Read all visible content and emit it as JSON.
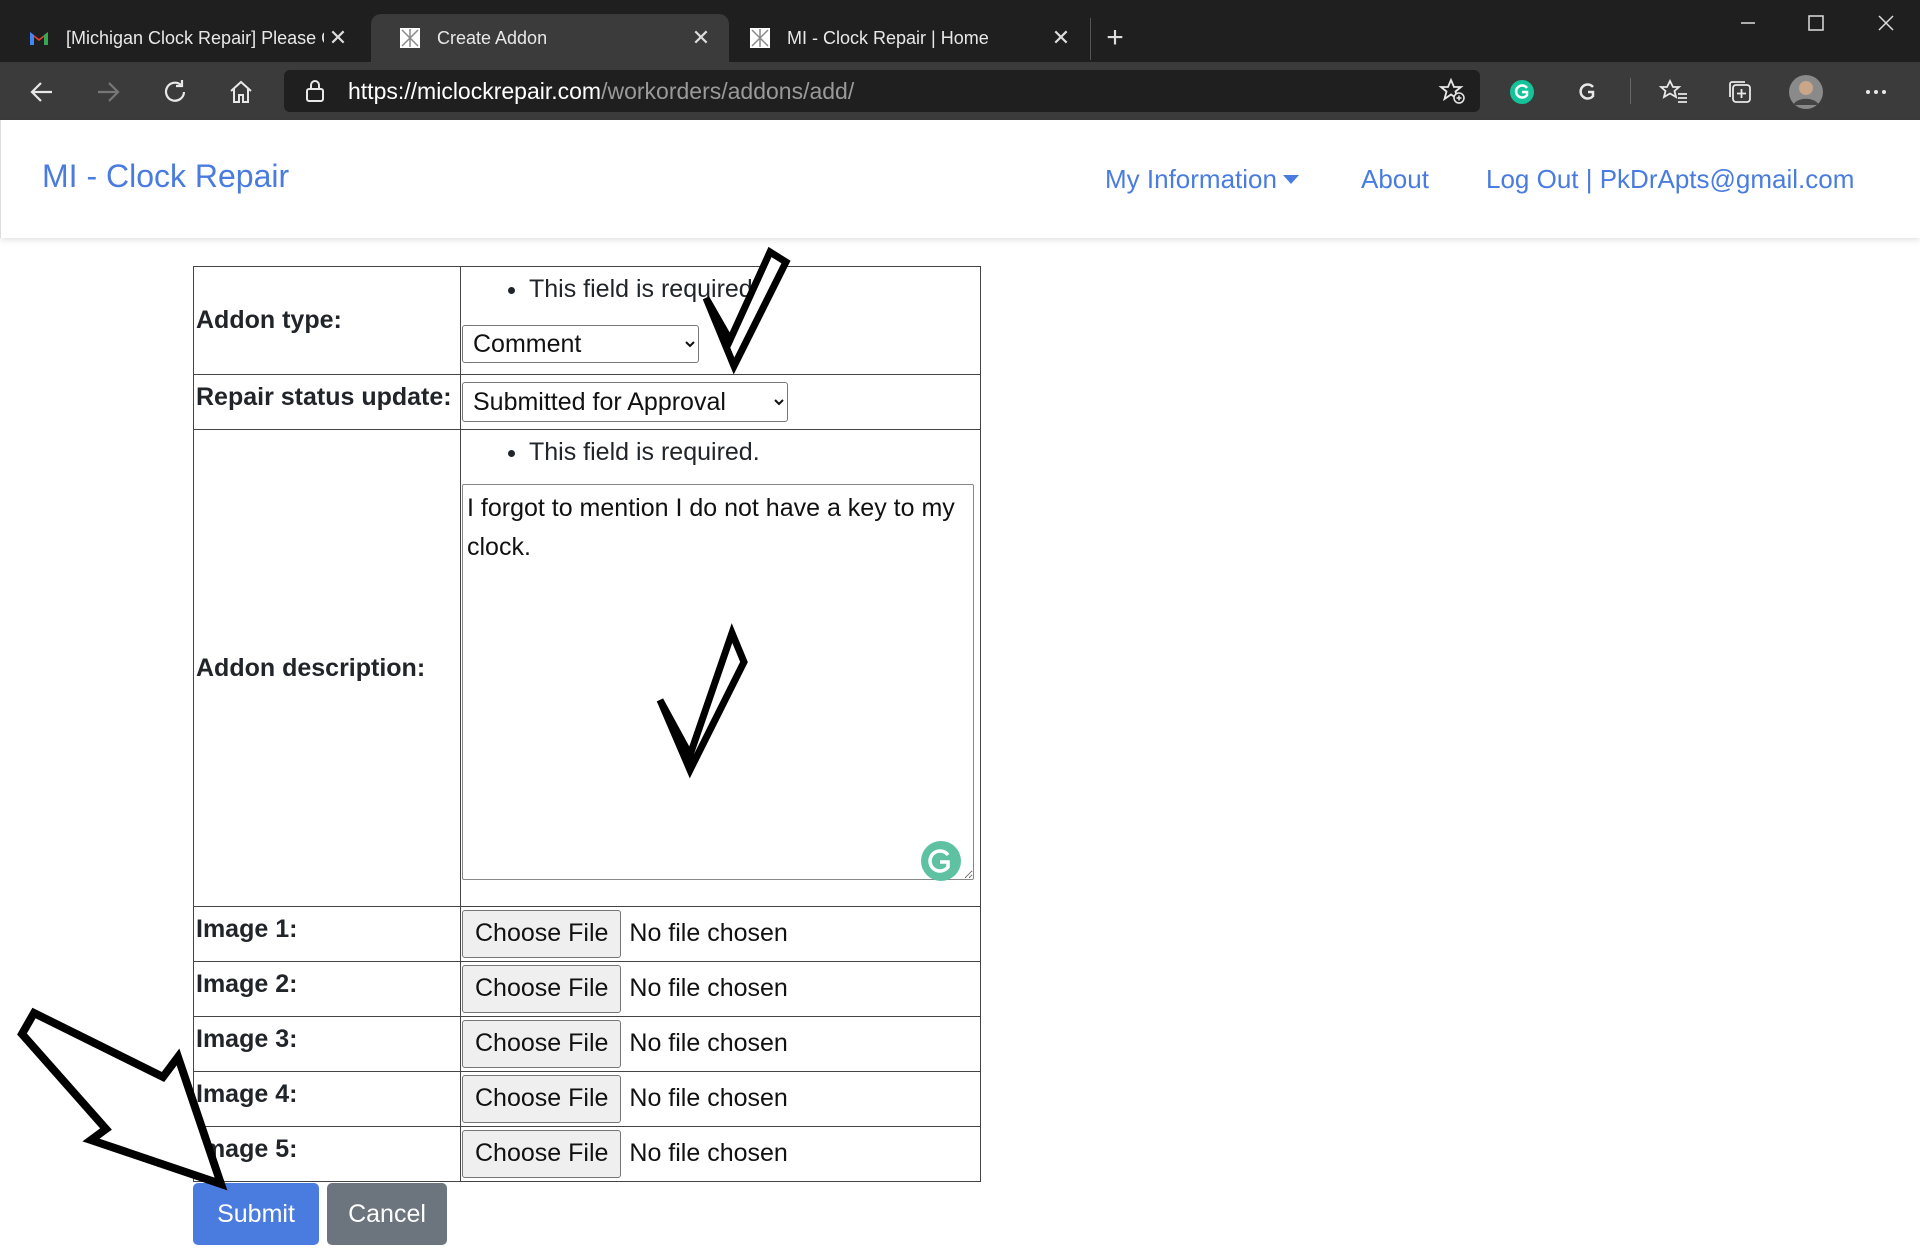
{
  "browser": {
    "tabs": [
      {
        "title": "[Michigan Clock Repair] Please C",
        "active": false,
        "icon": "gmail-icon"
      },
      {
        "title": "Create Addon",
        "active": true,
        "icon": "site-favicon"
      },
      {
        "title": "MI - Clock Repair | Home",
        "active": false,
        "icon": "site-favicon"
      }
    ],
    "url_prefix": "https://",
    "url_host": "miclockrepair.com",
    "url_path": "/workorders/addons/add/"
  },
  "navbar": {
    "brand": "MI - Clock Repair",
    "my_information": "My Information",
    "about": "About",
    "logout": "Log Out | PkDrApts@gmail.com",
    "link_color": "#4a7ce0"
  },
  "form": {
    "addon_type_label": "Addon type:",
    "addon_type_error": "This field is required.",
    "addon_type_value": "Comment",
    "repair_status_label": "Repair status update:",
    "repair_status_value": "Submitted for Approval",
    "description_label": "Addon description:",
    "description_error": "This field is required.",
    "description_value": "I forgot to mention I do not have a key to my clock.",
    "images": [
      {
        "label": "Image 1:",
        "button": "Choose File",
        "status": "No file chosen"
      },
      {
        "label": "Image 2:",
        "button": "Choose File",
        "status": "No file chosen"
      },
      {
        "label": "Image 3:",
        "button": "Choose File",
        "status": "No file chosen"
      },
      {
        "label": "Image 4:",
        "button": "Choose File",
        "status": "No file chosen"
      },
      {
        "label": "Image 5:",
        "button": "Choose File",
        "status": "No file chosen"
      }
    ],
    "submit": "Submit",
    "cancel": "Cancel",
    "submit_color": "#4a7ce0",
    "cancel_color": "#6c757d"
  }
}
